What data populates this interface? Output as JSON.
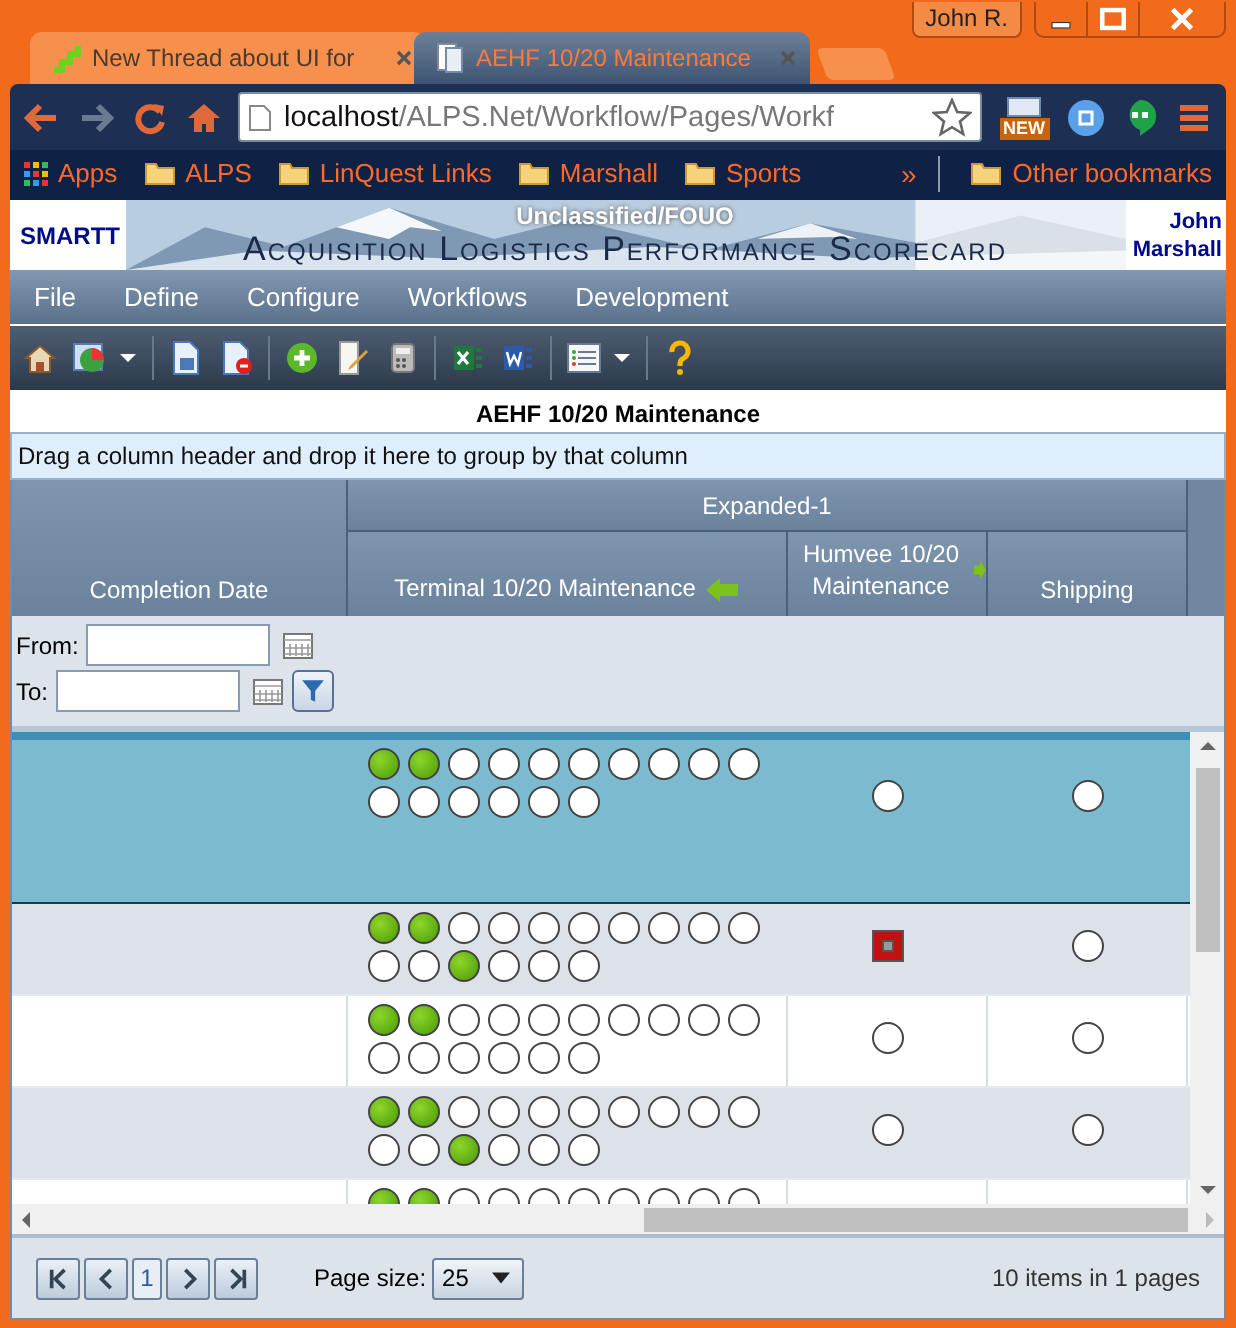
{
  "browser": {
    "profile": "John R.",
    "tabs": [
      {
        "title": "New Thread about UI for",
        "selected": false
      },
      {
        "title": "AEHF 10/20 Maintenance",
        "selected": true
      }
    ],
    "url_host": "localhost",
    "url_path": "/ALPS.Net/Workflow/Pages/Workf",
    "new_badge": "NEW",
    "bookmarks": [
      "Apps",
      "ALPS",
      "LinQuest Links",
      "Marshall",
      "Sports"
    ],
    "overflow": "»",
    "other_bookmarks": "Other bookmarks"
  },
  "app": {
    "brand": "SMARTT",
    "classification": "Unclassified/FOUO",
    "title": "Acquisition Logistics Performance Scorecard",
    "user": "John Marshall"
  },
  "menu": [
    "File",
    "Define",
    "Configure",
    "Workflows",
    "Development"
  ],
  "grid": {
    "title": "AEHF 10/20 Maintenance",
    "group_hint": "Drag a column header and drop it here to group by that column",
    "group_header": "Expanded-1",
    "columns": [
      "Completion Date",
      "Terminal 10/20 Maintenance",
      "Humvee 10/20 Maintenance",
      "Shipping"
    ],
    "filter": {
      "from_label": "From:",
      "to_label": "To:"
    },
    "rows": [
      {
        "selected": true,
        "terminal": [
          true,
          true,
          false,
          false,
          false,
          false,
          false,
          false,
          false,
          false,
          false,
          false,
          false,
          false,
          false,
          false
        ],
        "humvee_late": false,
        "shipping_late": false
      },
      {
        "selected": false,
        "terminal": [
          true,
          true,
          false,
          false,
          false,
          false,
          false,
          false,
          false,
          false,
          false,
          false,
          true,
          false,
          false,
          false
        ],
        "humvee_late": true,
        "shipping_late": false
      },
      {
        "selected": false,
        "terminal": [
          true,
          true,
          false,
          false,
          false,
          false,
          false,
          false,
          false,
          false,
          false,
          false,
          false,
          false,
          false,
          false
        ],
        "humvee_late": false,
        "shipping_late": false
      },
      {
        "selected": false,
        "terminal": [
          true,
          true,
          false,
          false,
          false,
          false,
          false,
          false,
          false,
          false,
          false,
          false,
          true,
          false,
          false,
          false
        ],
        "humvee_late": false,
        "shipping_late": false
      },
      {
        "selected": false,
        "terminal": [
          true,
          true,
          false,
          false,
          false,
          false,
          false,
          false,
          false,
          false
        ]
      }
    ]
  },
  "pager": {
    "page": "1",
    "page_size_label": "Page size:",
    "page_size": "25",
    "summary": "10 items in 1 pages"
  }
}
